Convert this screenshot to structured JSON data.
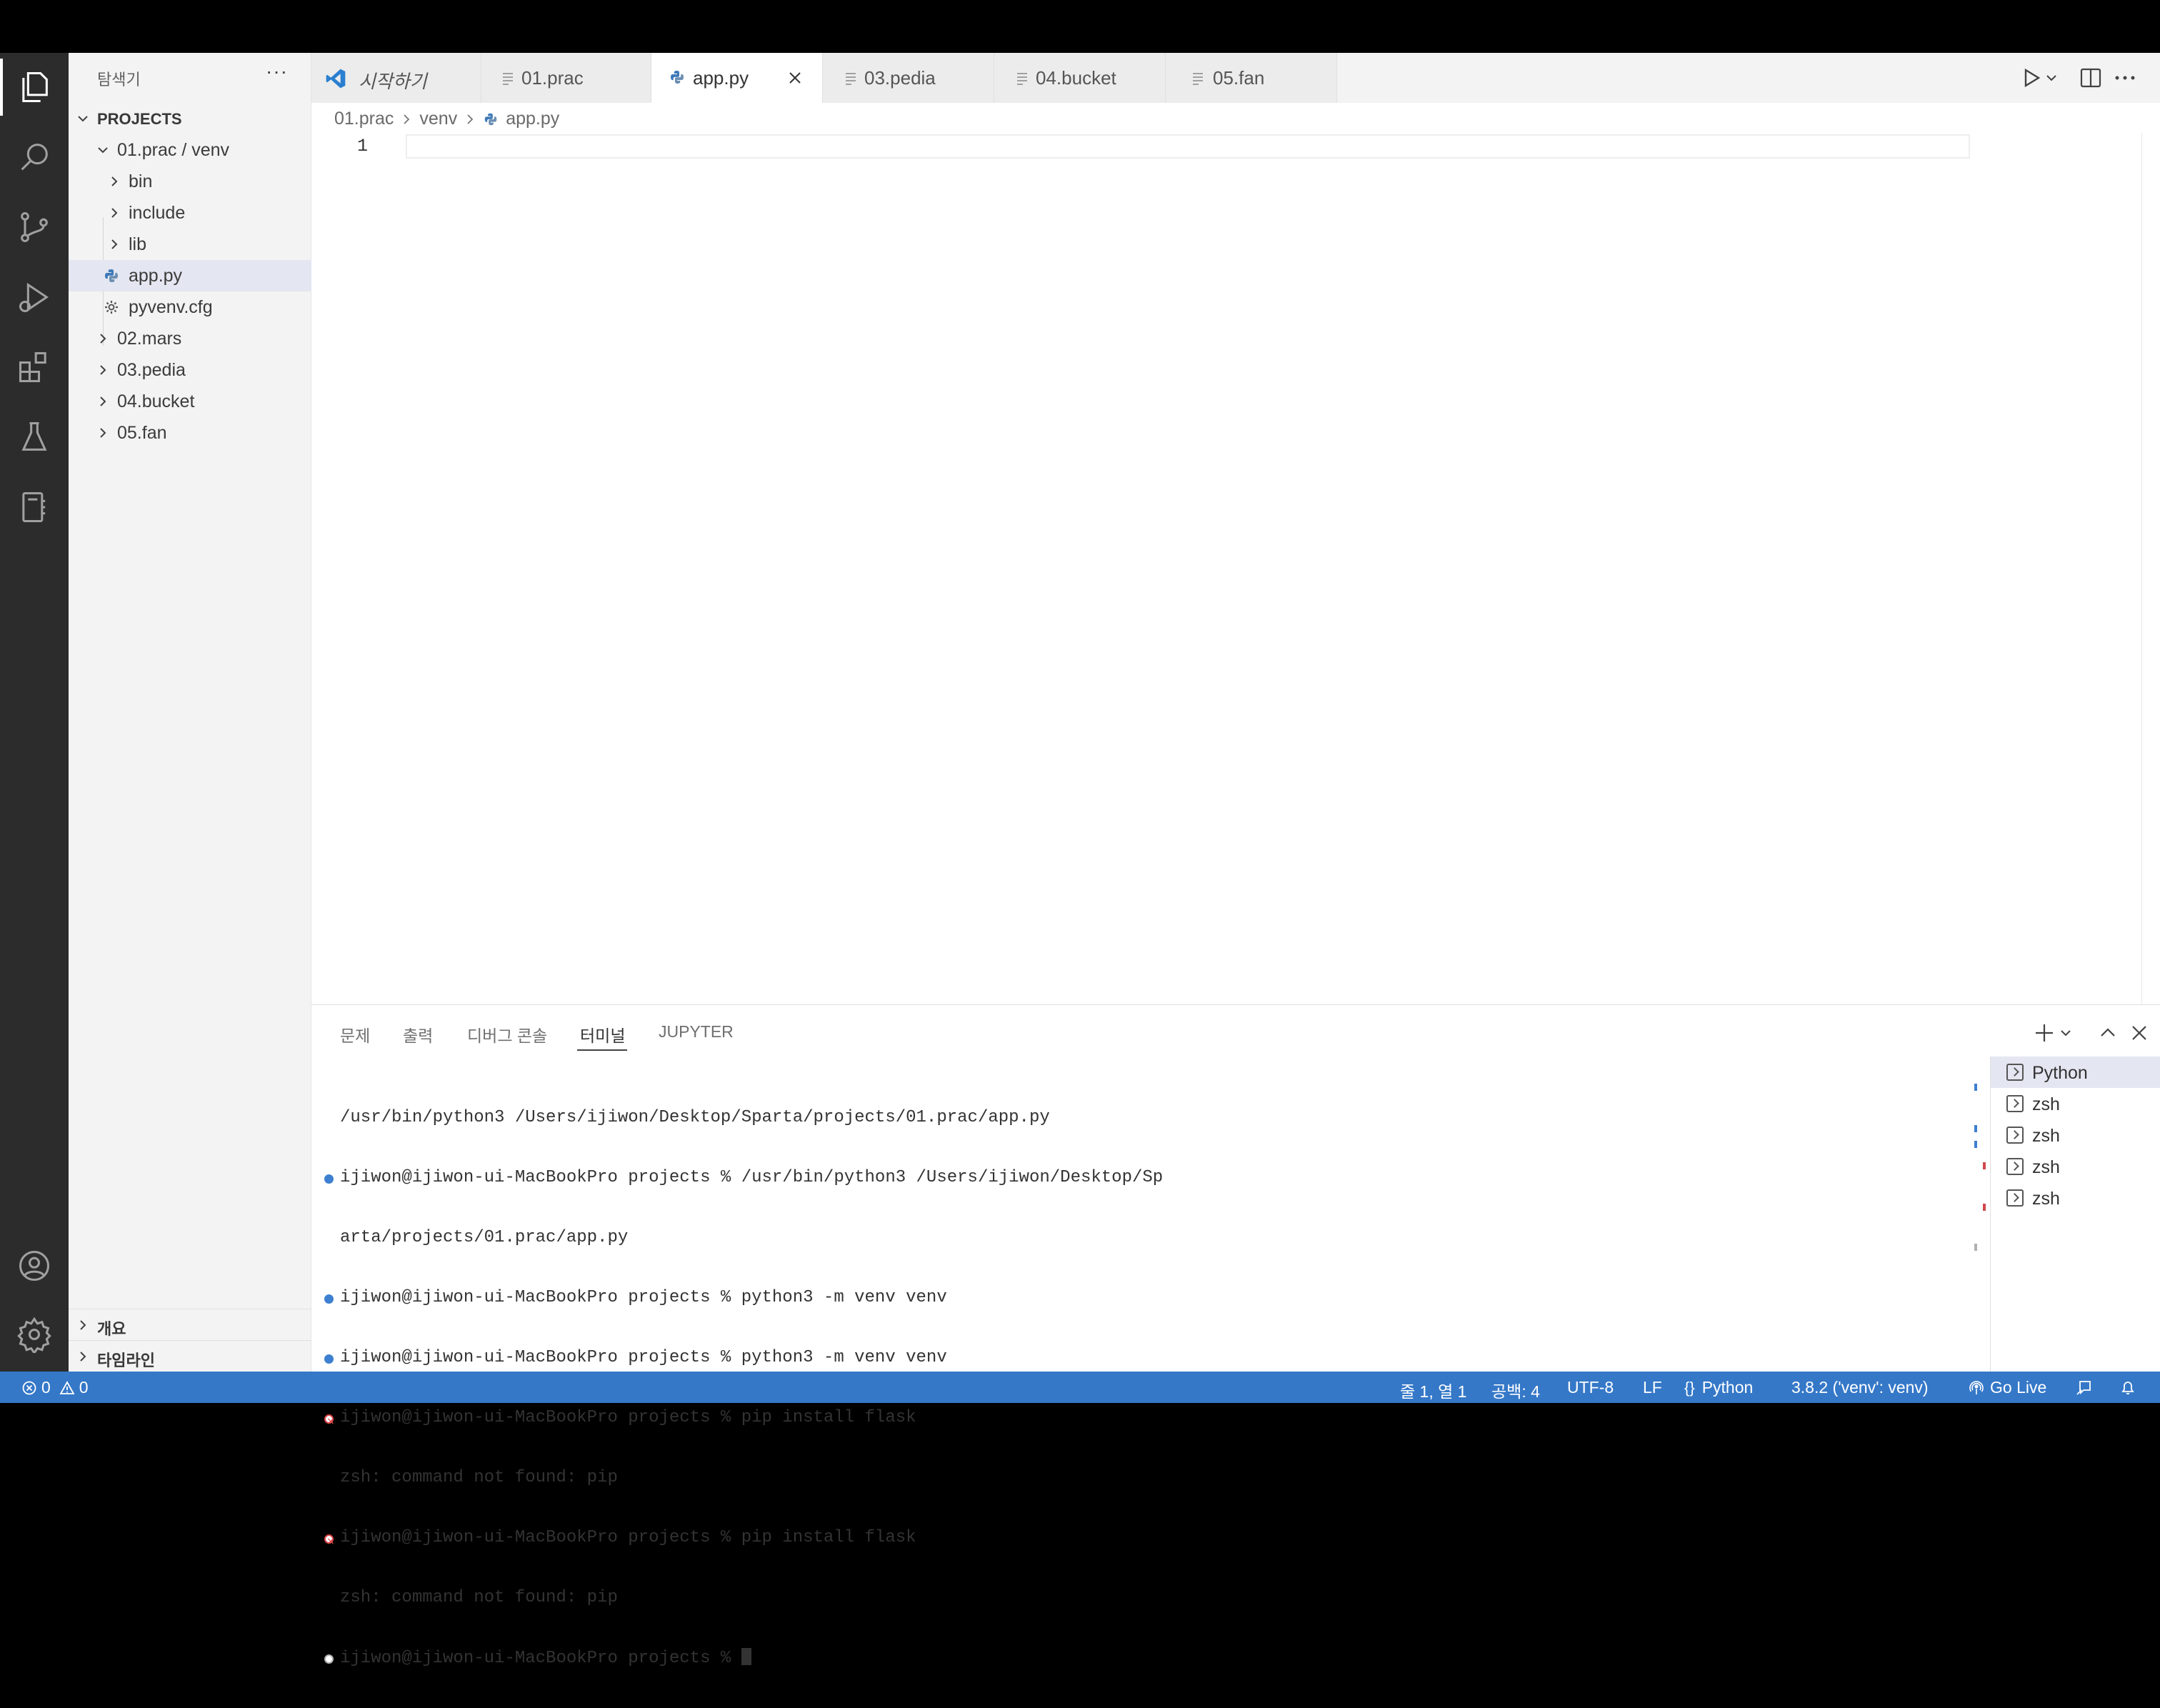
{
  "sidebar": {
    "title": "탐색기",
    "more": "···",
    "section": "PROJECTS",
    "tree": [
      {
        "label": "01.prac / venv"
      },
      {
        "label": "bin"
      },
      {
        "label": "include"
      },
      {
        "label": "lib"
      },
      {
        "label": "app.py"
      },
      {
        "label": "pyvenv.cfg"
      },
      {
        "label": "02.mars"
      },
      {
        "label": "03.pedia"
      },
      {
        "label": "04.bucket"
      },
      {
        "label": "05.fan"
      }
    ],
    "outline": "개요",
    "timeline": "타임라인"
  },
  "tabs": [
    {
      "label": "시작하기"
    },
    {
      "label": "01.prac"
    },
    {
      "label": "app.py"
    },
    {
      "label": "03.pedia"
    },
    {
      "label": "04.bucket"
    },
    {
      "label": "05.fan"
    }
  ],
  "editor": {
    "breadcrumb": [
      "01.prac",
      "venv",
      "app.py"
    ],
    "line_number": "1"
  },
  "panel": {
    "tabs": [
      "문제",
      "출력",
      "디버그 콘솔",
      "터미널",
      "JUPYTER"
    ],
    "active_tab": "터미널",
    "terminal_lines": [
      "/usr/bin/python3 /Users/ijiwon/Desktop/Sparta/projects/01.prac/app.py",
      "ijiwon@ijiwon-ui-MacBookPro projects % /usr/bin/python3 /Users/ijiwon/Desktop/Sp",
      "arta/projects/01.prac/app.py",
      "ijiwon@ijiwon-ui-MacBookPro projects % python3 -m venv venv",
      "ijiwon@ijiwon-ui-MacBookPro projects % python3 -m venv venv",
      "ijiwon@ijiwon-ui-MacBookPro projects % pip install flask",
      "zsh: command not found: pip",
      "ijiwon@ijiwon-ui-MacBookPro projects % pip install flask",
      "zsh: command not found: pip",
      "ijiwon@ijiwon-ui-MacBookPro projects % "
    ],
    "terminals": [
      "Python",
      "zsh",
      "zsh",
      "zsh",
      "zsh"
    ]
  },
  "statusbar": {
    "errors": "0",
    "warnings": "0",
    "position": "줄 1, 열 1",
    "spaces": "공백: 4",
    "encoding": "UTF-8",
    "eol": "LF",
    "language": "Python",
    "interpreter": "3.8.2 ('venv': venv)",
    "golive": "Go Live"
  },
  "colors": {
    "statusbar": "#3578c8",
    "activitybar": "#2c2c2c",
    "sidebar": "#f3f3f3",
    "selection": "#e4e6f1"
  }
}
